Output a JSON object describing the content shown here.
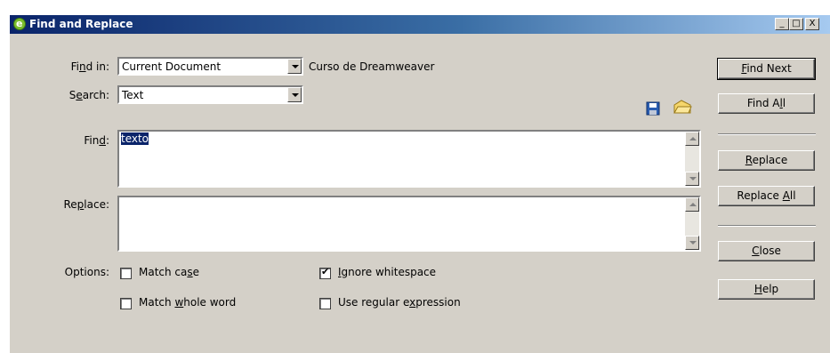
{
  "window": {
    "title": "Find and Replace"
  },
  "titlebar_buttons": {
    "minimize": "_",
    "maximize": "□",
    "close": "X"
  },
  "find_in": {
    "label_pre": "Fi",
    "label_u": "n",
    "label_post": "d in:",
    "value": "Current Document",
    "doc_name": "Curso de Dreamweaver"
  },
  "search": {
    "label_pre": "S",
    "label_u": "e",
    "label_post": "arch:",
    "value": "Text"
  },
  "find": {
    "label_pre": "Fin",
    "label_u": "d",
    "label_post": ":",
    "value": "texto"
  },
  "replace": {
    "label_pre": "Re",
    "label_u": "p",
    "label_post": "lace:",
    "value": ""
  },
  "options": {
    "label": "Options:",
    "match_case": {
      "pre": "Match ca",
      "u": "s",
      "post": "e",
      "checked": false
    },
    "match_whole_word": {
      "pre": "Match ",
      "u": "w",
      "post": "hole word",
      "checked": false
    },
    "ignore_whitespace": {
      "pre": "",
      "u": "I",
      "post": "gnore whitespace",
      "checked": true
    },
    "use_regex": {
      "pre": "Use regular e",
      "u": "x",
      "post": "pression",
      "checked": false
    }
  },
  "buttons": {
    "find_next": {
      "pre": "",
      "u": "F",
      "post": "ind Next"
    },
    "find_all": {
      "pre": "Find A",
      "u": "l",
      "post": "l"
    },
    "replace": {
      "pre": "",
      "u": "R",
      "post": "eplace"
    },
    "replace_all": {
      "pre": "Replace ",
      "u": "A",
      "post": "ll"
    },
    "close": {
      "pre": "",
      "u": "C",
      "post": "lose"
    },
    "help": {
      "pre": "",
      "u": "H",
      "post": "elp"
    }
  },
  "icons": {
    "save_query": "floppy-disk-icon",
    "load_query": "open-folder-icon"
  }
}
